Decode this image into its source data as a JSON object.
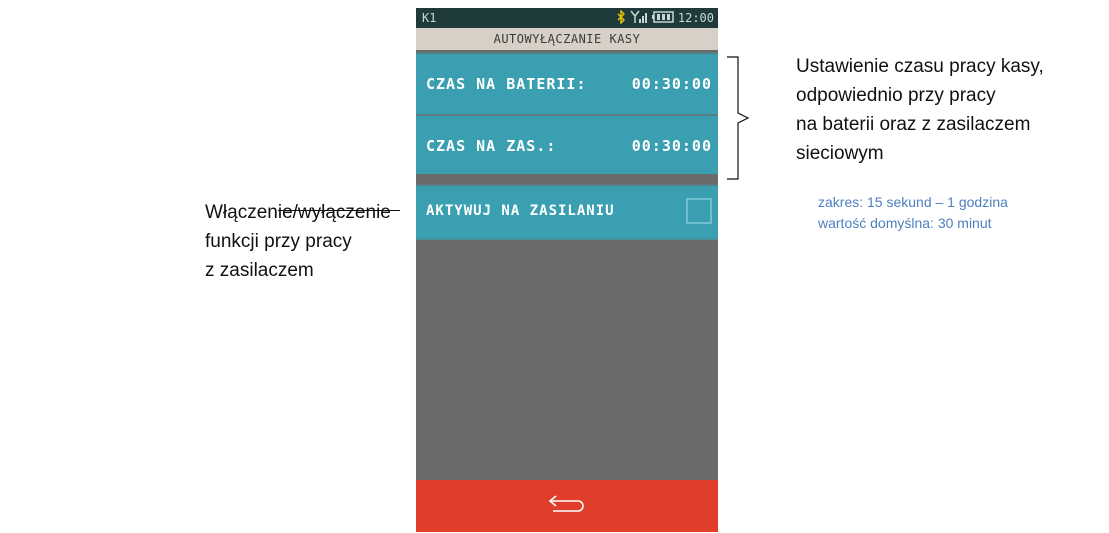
{
  "status_bar": {
    "device_id": "K1",
    "time": "12:00",
    "icons": [
      "bluetooth-icon",
      "signal-icon",
      "battery-icon"
    ]
  },
  "screen_title": "AUTOWYŁĄCZANIE KASY",
  "menu": {
    "battery_time": {
      "label": "CZAS NA BATERII:",
      "value": "00:30:00"
    },
    "power_time": {
      "label": "CZAS NA ZAS.:",
      "value": "00:30:00"
    },
    "activate_on_power": {
      "label": "AKTYWUJ NA ZASILANIU",
      "checked": false
    }
  },
  "bottom_bar": {
    "icon": "back-arrow-icon"
  },
  "annotations": {
    "right_lines": [
      "Ustawienie czasu pracy kasy,",
      "odpowiednio przy pracy",
      "na baterii oraz z zasilaczem",
      "sieciowym"
    ],
    "range_lines": [
      "zakres: 15 sekund – 1 godzina",
      "wartość domyślna: 30 minut"
    ],
    "left_lines": [
      "Włączenie/wyłączenie",
      "funkcji przy pracy",
      "z zasilaczem"
    ]
  },
  "colors": {
    "status_bar": "#1f3a3a",
    "title_bar": "#d6d0c7",
    "menu_item": "#3a9fb1",
    "screen_background": "#6b6a6a",
    "bottom_bar": "#e03e2a",
    "range_note": "#4f7fbf",
    "bluetooth": "#e9c700"
  }
}
